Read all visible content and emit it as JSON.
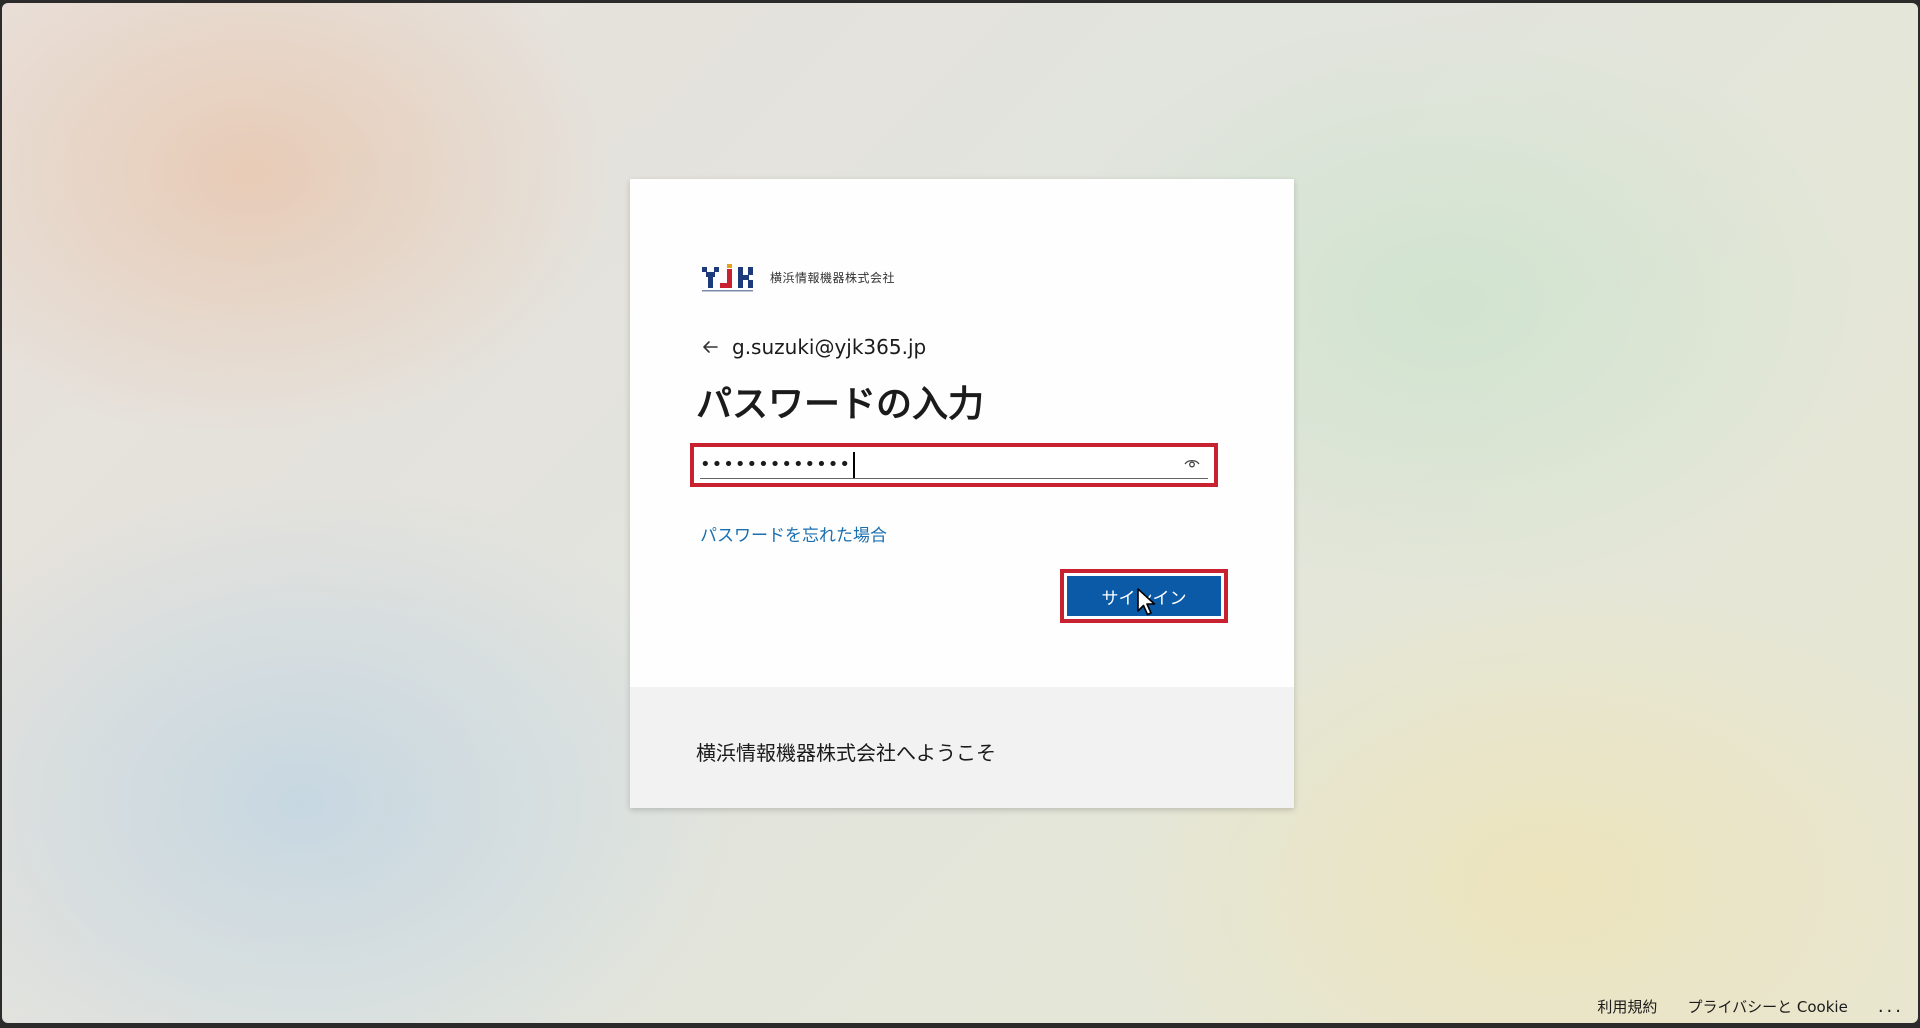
{
  "brand": {
    "logo_alt": "YJK",
    "company_name": "横浜情報機器株式会社"
  },
  "identity": {
    "email": "g.suzuki@yjk365.jp"
  },
  "form": {
    "title": "パスワードの入力",
    "password_value": "•••••••••••••",
    "forgot_password_link": "パスワードを忘れた場合",
    "signin_label": "サインイン"
  },
  "footer_card": {
    "welcome_text": "横浜情報機器株式会社へようこそ"
  },
  "page_footer": {
    "terms": "利用規約",
    "privacy": "プライバシーと Cookie",
    "more": "..."
  },
  "colors": {
    "accent": "#0b5aa8",
    "highlight_border": "#c8212f",
    "link": "#1a6fb0"
  },
  "icons": {
    "back": "back-arrow-icon",
    "reveal": "eye-icon",
    "cursor": "mouse-pointer-icon"
  }
}
